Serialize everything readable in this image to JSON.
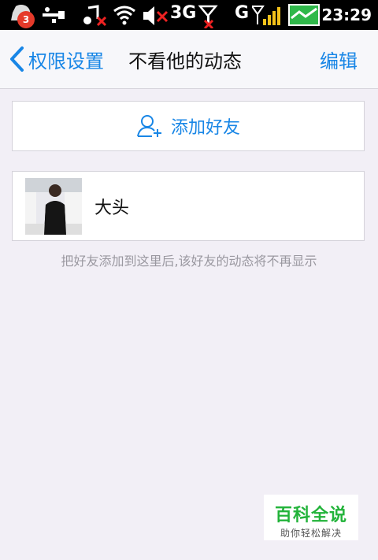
{
  "status_bar": {
    "notification_count": "3",
    "network_label": "3G",
    "carrier_label": "G",
    "time": "23:29"
  },
  "nav": {
    "back_label": "权限设置",
    "title": "不看他的动态",
    "edit_label": "编辑"
  },
  "add_friend": {
    "label": "添加好友"
  },
  "friends": [
    {
      "name": "大头"
    }
  ],
  "hint": "把好友添加到这里后,该好友的动态将不再显示",
  "watermark": {
    "title": "百科全说",
    "subtitle": "助你轻松解决"
  },
  "colors": {
    "accent": "#1886e6",
    "background": "#f2eff6",
    "status_bar": "#000000"
  }
}
